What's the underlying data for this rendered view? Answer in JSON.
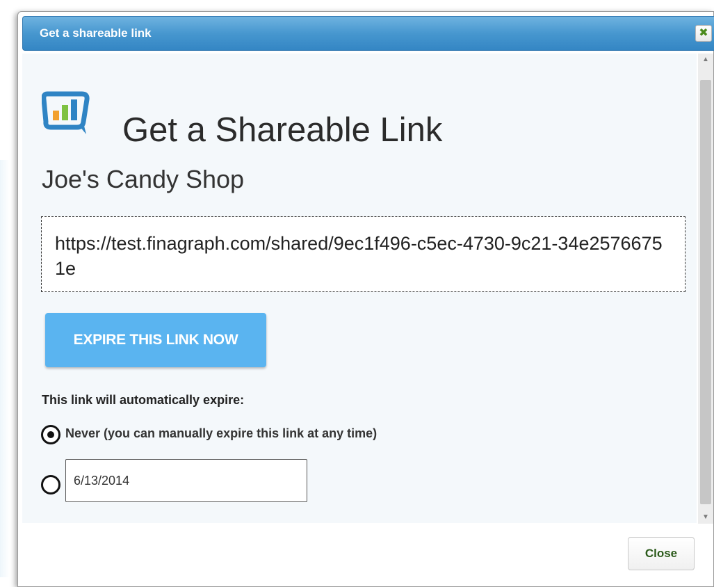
{
  "dialog": {
    "title": "Get a shareable link",
    "close_icon": "close-x-icon",
    "accent_color": "#4797cf"
  },
  "logo": {
    "icon": "finagraph-logo-icon",
    "colors": [
      "#2f84c4",
      "#7ec242",
      "#f2a12e"
    ]
  },
  "heading": "Get a Shareable Link",
  "company": "Joe's Candy Shop",
  "share_link": "https://test.finagraph.com/shared/9ec1f496-c5ec-4730-9c21-34e25766751e",
  "expire_button": {
    "label": "EXPIRE THIS LINK NOW",
    "color": "#5ab4f0"
  },
  "auto_expire": {
    "label": "This link will automatically expire:",
    "options": [
      {
        "label": "Never (you can manually expire this link at any time)",
        "selected": true
      },
      {
        "value": "6/13/2014",
        "selected": false
      }
    ]
  },
  "footer": {
    "close_label": "Close"
  }
}
